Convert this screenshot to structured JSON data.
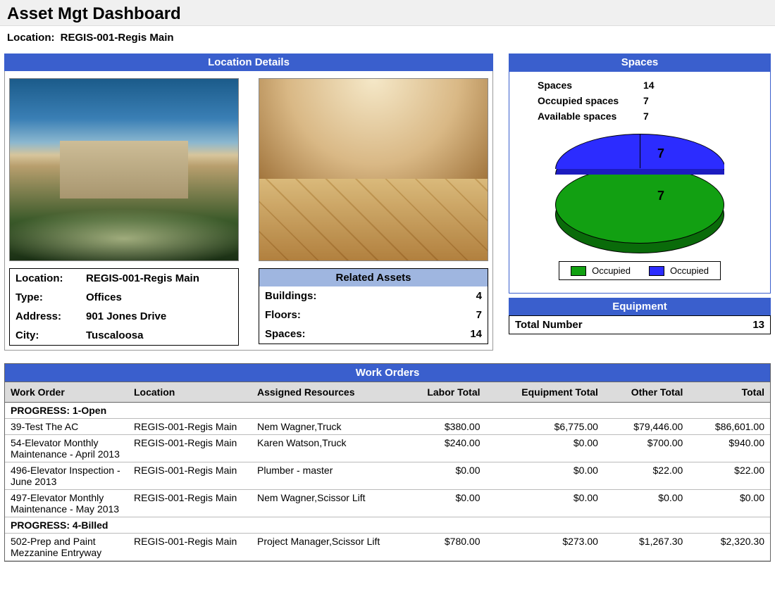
{
  "header": {
    "title": "Asset Mgt Dashboard",
    "location_label": "Location:",
    "location_value": "REGIS-001-Regis Main"
  },
  "location_details": {
    "panel_title": "Location Details",
    "info": {
      "location_label": "Location:",
      "location_value": "REGIS-001-Regis Main",
      "type_label": "Type:",
      "type_value": "Offices",
      "address_label": "Address:",
      "address_value": "901 Jones Drive",
      "city_label": "City:",
      "city_value": "Tuscaloosa"
    },
    "related_assets": {
      "panel_title": "Related Assets",
      "buildings_label": "Buildings:",
      "buildings_value": "4",
      "floors_label": "Floors:",
      "floors_value": "7",
      "spaces_label": "Spaces:",
      "spaces_value": "14"
    }
  },
  "spaces": {
    "panel_title": "Spaces",
    "rows": {
      "spaces_label": "Spaces",
      "spaces_value": "14",
      "occupied_label": "Occupied spaces",
      "occupied_value": "7",
      "available_label": "Available spaces",
      "available_value": "7"
    },
    "pie_top_label": "7",
    "pie_bottom_label": "7",
    "legend_a": "Occupied",
    "legend_b": "Occupied"
  },
  "equipment": {
    "panel_title": "Equipment",
    "total_label": "Total Number",
    "total_value": "13"
  },
  "work_orders": {
    "panel_title": "Work Orders",
    "columns": {
      "wo": "Work Order",
      "loc": "Location",
      "res": "Assigned Resources",
      "labor": "Labor Total",
      "equip": "Equipment Total",
      "other": "Other Total",
      "total": "Total"
    },
    "group1_label": "PROGRESS: 1-Open",
    "group1_rows": [
      {
        "wo": "39-Test The AC",
        "loc": "REGIS-001-Regis Main",
        "res": "Nem Wagner,Truck",
        "labor": "$380.00",
        "equip": "$6,775.00",
        "other": "$79,446.00",
        "total": "$86,601.00"
      },
      {
        "wo": "54-Elevator Monthly Maintenance - April 2013",
        "loc": "REGIS-001-Regis Main",
        "res": "Karen Watson,Truck",
        "labor": "$240.00",
        "equip": "$0.00",
        "other": "$700.00",
        "total": "$940.00"
      },
      {
        "wo": "496-Elevator Inspection - June 2013",
        "loc": "REGIS-001-Regis Main",
        "res": "Plumber - master",
        "labor": "$0.00",
        "equip": "$0.00",
        "other": "$22.00",
        "total": "$22.00"
      },
      {
        "wo": "497-Elevator Monthly Maintenance - May 2013",
        "loc": "REGIS-001-Regis Main",
        "res": "Nem Wagner,Scissor Lift",
        "labor": "$0.00",
        "equip": "$0.00",
        "other": "$0.00",
        "total": "$0.00"
      }
    ],
    "group2_label": "PROGRESS: 4-Billed",
    "group2_rows": [
      {
        "wo": "502-Prep and Paint Mezzanine Entryway",
        "loc": "REGIS-001-Regis Main",
        "res": "Project Manager,Scissor Lift",
        "labor": "$780.00",
        "equip": "$273.00",
        "other": "$1,267.30",
        "total": "$2,320.30"
      }
    ]
  },
  "chart_data": {
    "type": "pie",
    "title": "Spaces",
    "series": [
      {
        "name": "Occupied",
        "value": 7,
        "color": "#12a012"
      },
      {
        "name": "Occupied",
        "value": 7,
        "color": "#2c2cff"
      }
    ]
  }
}
